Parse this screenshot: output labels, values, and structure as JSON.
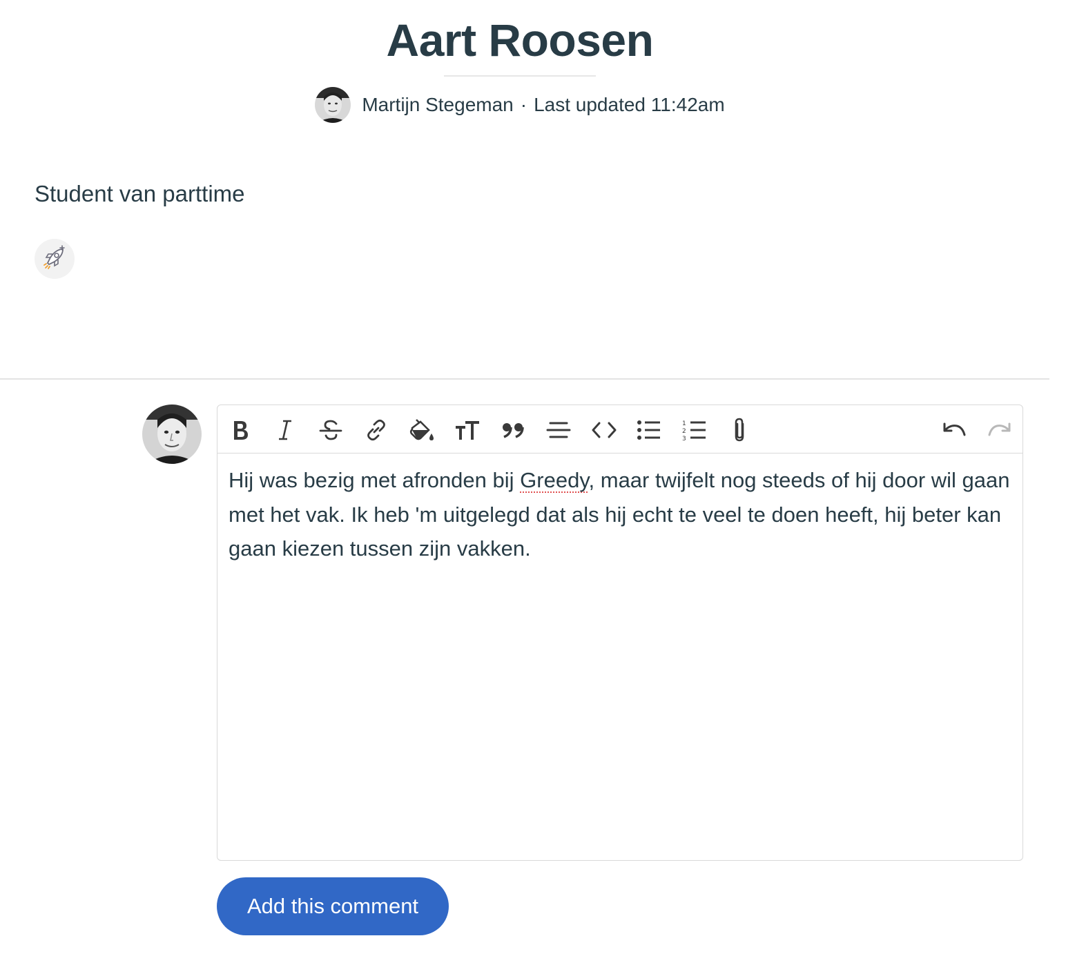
{
  "document": {
    "title": "Aart Roosen",
    "author": "Martijn Stegeman",
    "separator": "·",
    "updated": "Last updated 11:42am",
    "description": "Student van parttime"
  },
  "icons": {
    "boost": "rocket-boost-icon",
    "author_avatar": "avatar-photo",
    "commenter_avatar": "avatar-photo"
  },
  "editor": {
    "toolbar": [
      "bold",
      "italic",
      "strikethrough",
      "link",
      "highlight-color",
      "text-size",
      "quote",
      "horizontal-rule",
      "code",
      "bullet-list",
      "numbered-list",
      "attach-file",
      "undo",
      "redo"
    ],
    "text_before": "Hij was bezig met afronden bij ",
    "misspelled_word": "Greedy",
    "text_after": ", maar twijfelt nog steeds of hij door wil gaan met het vak. Ik heb 'm uitgelegd dat als hij echt te veel te doen heeft, hij beter kan gaan kiezen tussen zijn vakken."
  },
  "actions": {
    "submit_label": "Add this comment"
  },
  "colors": {
    "text": "#283c46",
    "button_bg": "#3168c6",
    "button_text": "#ffffff",
    "border": "#d9d9d9"
  }
}
